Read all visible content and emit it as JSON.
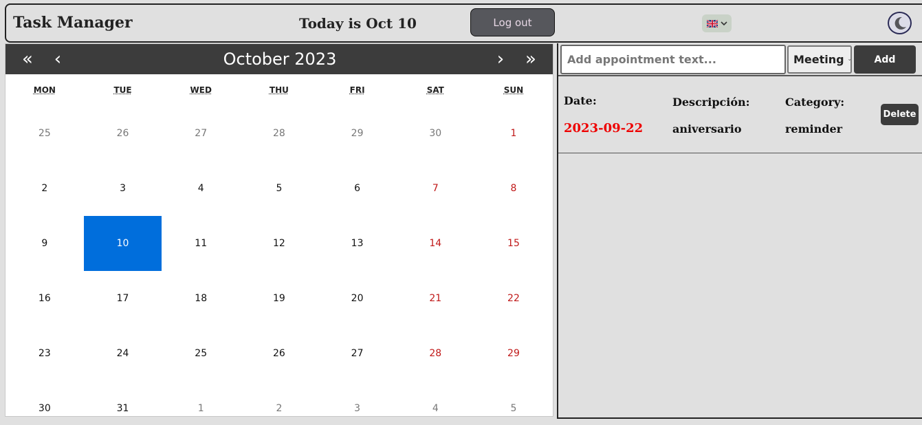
{
  "header": {
    "title": "Task Manager",
    "today": "Today is Oct 10",
    "logout_label": "Log out",
    "language_icon": "uk-flag-icon",
    "theme_icon": "moon-icon"
  },
  "calendar": {
    "month_label": "October 2023",
    "nav": {
      "prev_year": "«",
      "prev_month": "‹",
      "next_month": "›",
      "next_year": "»"
    },
    "weekdays": [
      "MON",
      "TUE",
      "WED",
      "THU",
      "FRI",
      "SAT",
      "SUN"
    ],
    "days": [
      {
        "label": "25",
        "other": true
      },
      {
        "label": "26",
        "other": true
      },
      {
        "label": "27",
        "other": true
      },
      {
        "label": "28",
        "other": true
      },
      {
        "label": "29",
        "other": true
      },
      {
        "label": "30",
        "other": true
      },
      {
        "label": "1",
        "other": false
      },
      {
        "label": "2",
        "other": false
      },
      {
        "label": "3",
        "other": false
      },
      {
        "label": "4",
        "other": false
      },
      {
        "label": "5",
        "other": false
      },
      {
        "label": "6",
        "other": false
      },
      {
        "label": "7",
        "other": false
      },
      {
        "label": "8",
        "other": false
      },
      {
        "label": "9",
        "other": false
      },
      {
        "label": "10",
        "other": false,
        "selected": true
      },
      {
        "label": "11",
        "other": false
      },
      {
        "label": "12",
        "other": false
      },
      {
        "label": "13",
        "other": false
      },
      {
        "label": "14",
        "other": false
      },
      {
        "label": "15",
        "other": false
      },
      {
        "label": "16",
        "other": false
      },
      {
        "label": "17",
        "other": false
      },
      {
        "label": "18",
        "other": false
      },
      {
        "label": "19",
        "other": false
      },
      {
        "label": "20",
        "other": false
      },
      {
        "label": "21",
        "other": false
      },
      {
        "label": "22",
        "other": false
      },
      {
        "label": "23",
        "other": false
      },
      {
        "label": "24",
        "other": false
      },
      {
        "label": "25",
        "other": false
      },
      {
        "label": "26",
        "other": false
      },
      {
        "label": "27",
        "other": false
      },
      {
        "label": "28",
        "other": false
      },
      {
        "label": "29",
        "other": false
      },
      {
        "label": "30",
        "other": false
      },
      {
        "label": "31",
        "other": false
      },
      {
        "label": "1",
        "other": true
      },
      {
        "label": "2",
        "other": true
      },
      {
        "label": "3",
        "other": true
      },
      {
        "label": "4",
        "other": true
      },
      {
        "label": "5",
        "other": true
      }
    ],
    "colors": {
      "weekend": "#c01818",
      "selected": "#006edc",
      "nav_bg": "#3c3c3c"
    }
  },
  "appointment_form": {
    "placeholder": "Add appointment text...",
    "value": "",
    "category_selected": "Meeting",
    "add_label": "Add"
  },
  "appointments": {
    "labels": {
      "date": "Date:",
      "description": "Descripción:",
      "category": "Category:"
    },
    "items": [
      {
        "date": "2023-09-22",
        "description": "aniversario",
        "category": "reminder",
        "delete_label": "Delete"
      }
    ]
  }
}
